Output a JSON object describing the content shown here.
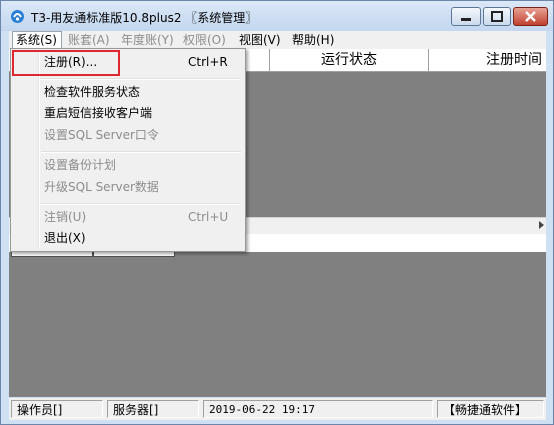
{
  "window": {
    "title": "T3-用友通标准版10.8plus2 〖系统管理〗",
    "icon": "app-logo-icon",
    "controls": {
      "minimize": "minimize-icon",
      "maximize": "maximize-icon",
      "close": "close-icon"
    }
  },
  "menubar": {
    "items": [
      {
        "label": "系统(S)",
        "enabled": true,
        "active": true
      },
      {
        "label": "账套(A)",
        "enabled": false
      },
      {
        "label": "年度账(Y)",
        "enabled": false
      },
      {
        "label": "权限(O)",
        "enabled": false
      },
      {
        "label": "视图(V)",
        "enabled": true
      },
      {
        "label": "帮助(H)",
        "enabled": true
      }
    ]
  },
  "dropdown": {
    "items": [
      {
        "label": "注册(R)...",
        "shortcut": "Ctrl+R",
        "enabled": true,
        "highlighted": true
      },
      {
        "label": "检查软件服务状态",
        "shortcut": "",
        "enabled": true
      },
      {
        "label": "重启短信接收客户端",
        "shortcut": "",
        "enabled": true
      },
      {
        "label": "设置SQL Server口令",
        "shortcut": "",
        "enabled": false
      },
      {
        "label": "设置备份计划",
        "shortcut": "",
        "enabled": false
      },
      {
        "label": "升级SQL Server数据",
        "shortcut": "",
        "enabled": false
      },
      {
        "label": "注销(U)",
        "shortcut": "Ctrl+U",
        "enabled": false
      },
      {
        "label": "退出(X)",
        "shortcut": "",
        "enabled": true
      }
    ]
  },
  "table": {
    "columns": [
      "运行状态",
      "注册时间"
    ]
  },
  "statusbar": {
    "operator": "操作员[]",
    "server": "服务器[]",
    "datetime": "2019-06-22 19:17",
    "product": "【畅捷通软件】"
  },
  "colors": {
    "highlight_box": "#e0262e",
    "window_frame": "#cfe0f3",
    "client_bg": "#808080"
  }
}
